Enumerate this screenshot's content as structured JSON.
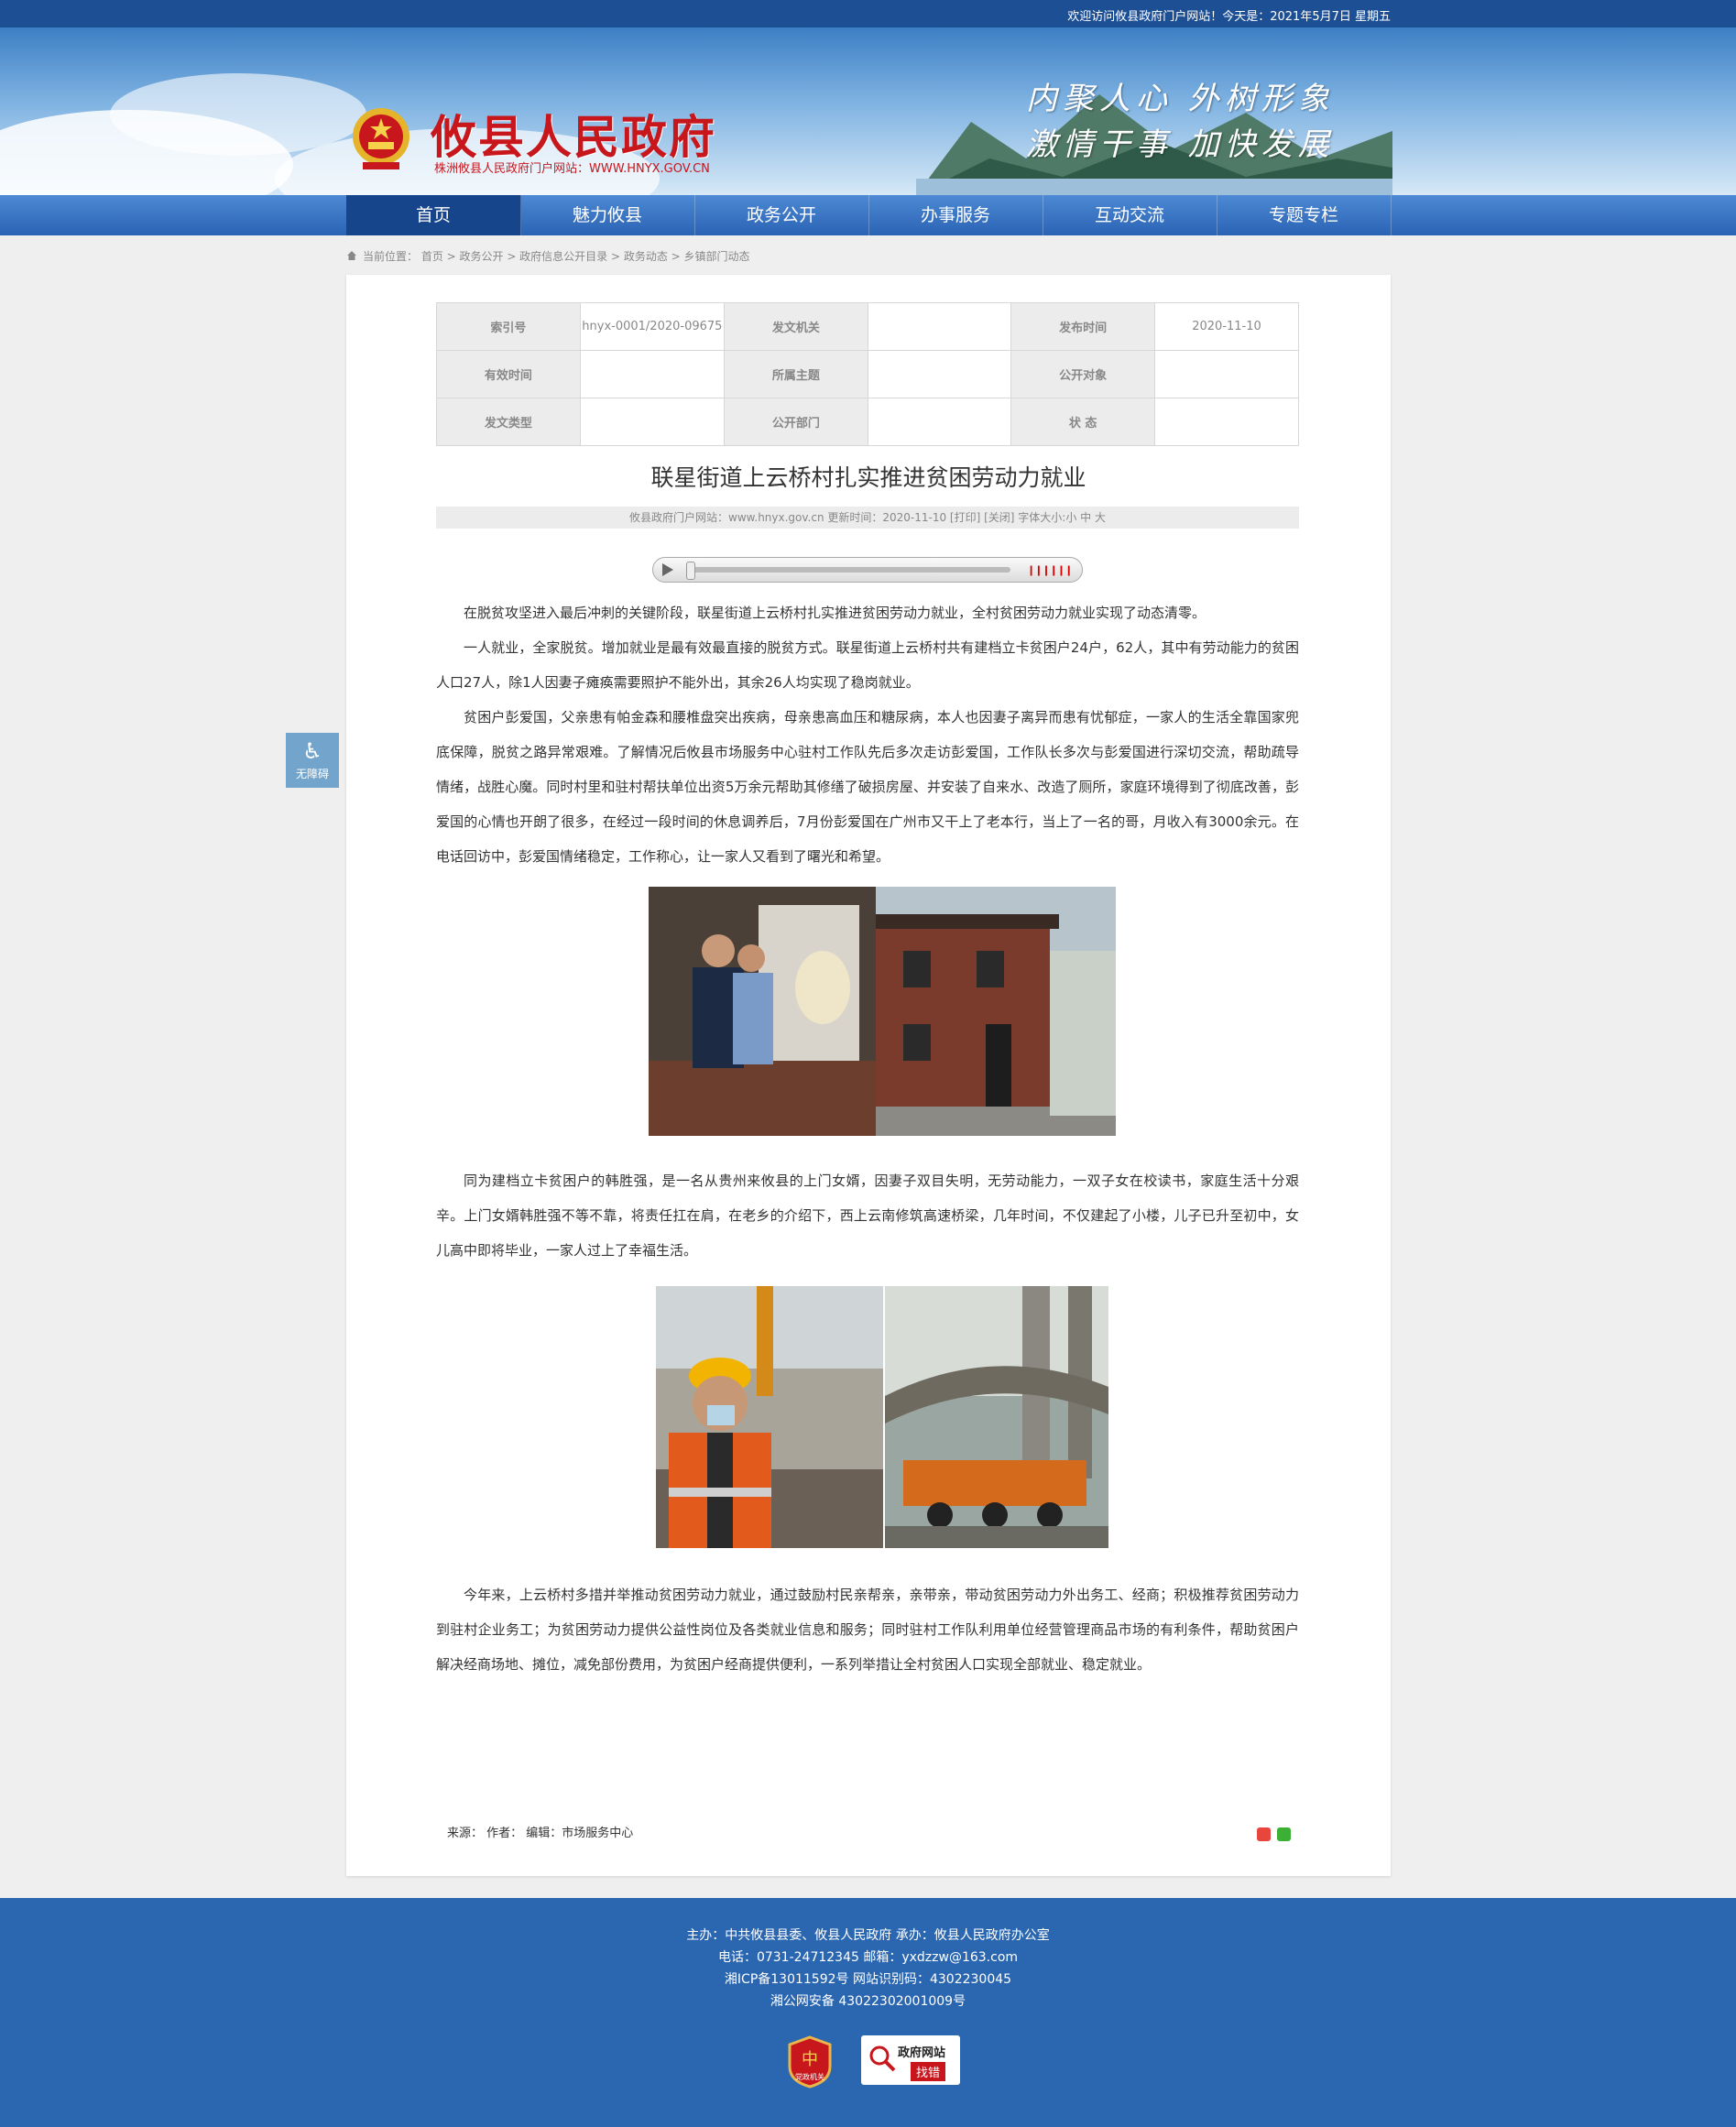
{
  "topbar": {
    "welcome": "欢迎访问攸县政府门户网站！今天是：2021年5月7日 星期五"
  },
  "header": {
    "title": "攸县人民政府",
    "subtitle": "株洲攸县人民政府门户网站：WWW.HNYX.GOV.CN",
    "slogan_line1": "内聚人心 外树形象",
    "slogan_line2": "激情干事 加快发展"
  },
  "nav": {
    "items": [
      "首页",
      "魅力攸县",
      "政务公开",
      "办事服务",
      "互动交流",
      "专题专栏"
    ]
  },
  "breadcrumb": {
    "text": "当前位置： 首页 > 政务公开 > 政府信息公开目录 > 政务动态 > 乡镇部门动态"
  },
  "meta": {
    "rows": [
      [
        {
          "label": "索引号",
          "value": "hnyx-0001/2020-09675"
        },
        {
          "label": "发文机关",
          "value": ""
        },
        {
          "label": "发布时间",
          "value": "2020-11-10"
        }
      ],
      [
        {
          "label": "有效时间",
          "value": ""
        },
        {
          "label": "所属主题",
          "value": ""
        },
        {
          "label": "公开对象",
          "value": ""
        }
      ],
      [
        {
          "label": "发文类型",
          "value": ""
        },
        {
          "label": "公开部门",
          "value": ""
        },
        {
          "label": "状 态",
          "value": ""
        }
      ]
    ]
  },
  "article": {
    "title": "联星街道上云桥村扎实推进贫困劳动力就业",
    "info": "攸县政府门户网站：www.hnyx.gov.cn   更新时间：2020-11-10   [打印] [关闭]   字体大小:小 中 大",
    "p1": "在脱贫攻坚进入最后冲刺的关键阶段，联星街道上云桥村扎实推进贫困劳动力就业，全村贫困劳动力就业实现了动态清零。",
    "p2": "一人就业，全家脱贫。增加就业是最有效最直接的脱贫方式。联星街道上云桥村共有建档立卡贫困户24户，62人，其中有劳动能力的贫困人口27人，除1人因妻子瘫痪需要照护不能外出，其余26人均实现了稳岗就业。",
    "p3": "贫困户彭爱国，父亲患有帕金森和腰椎盘突出疾病，母亲患高血压和糖尿病，本人也因妻子离异而患有忧郁症，一家人的生活全靠国家兜底保障，脱贫之路异常艰难。了解情况后攸县市场服务中心驻村工作队先后多次走访彭爱国，工作队长多次与彭爱国进行深切交流，帮助疏导情绪，战胜心魔。同时村里和驻村帮扶单位出资5万余元帮助其修缮了破损房屋、并安装了自来水、改造了厕所，家庭环境得到了彻底改善，彭爱国的心情也开朗了很多，在经过一段时间的休息调养后，7月份彭爱国在广州市又干上了老本行，当上了一名的哥，月收入有3000余元。在电话回访中，彭爱国情绪稳定，工作称心，让一家人又看到了曙光和希望。",
    "p4": "同为建档立卡贫困户的韩胜强，是一名从贵州来攸县的上门女婿，因妻子双目失明，无劳动能力，一双子女在校读书，家庭生活十分艰辛。上门女婿韩胜强不等不靠，将责任扛在肩，在老乡的介绍下，西上云南修筑高速桥梁，几年时间，不仅建起了小楼，儿子已升至初中，女儿高中即将毕业，一家人过上了幸福生活。",
    "p5": "今年来，上云桥村多措并举推动贫困劳动力就业，通过鼓励村民亲帮亲，亲带亲，带动贫困劳动力外出务工、经商；积极推荐贫困劳动力到驻村企业务工；为贫困劳动力提供公益性岗位及各类就业信息和服务；同时驻村工作队利用单位经营管理商品市场的有利条件，帮助贫困户解决经商场地、摊位，减免部份费用，为贫困户经商提供便利，一系列举措让全村贫困人口实现全部就业、稳定就业。",
    "source": "来源：     作者：     编辑：市场服务中心"
  },
  "a11y": {
    "label": "无障碍"
  },
  "footer": {
    "line1": "主办：中共攸县县委、攸县人民政府 承办：攸县人民政府办公室",
    "line2": "电话：0731-24712345 邮箱：yxdzzw@163.com",
    "line3": "湘ICP备13011592号   网站识别码：4302230045",
    "line4": "湘公网安备 43022302001009号",
    "badge1": "党政机关",
    "badge2_top": "政府网站",
    "badge2_bottom": "找错"
  },
  "colors": {
    "brand_red": "#c8161d",
    "nav_blue": "#2a63b4",
    "footer_blue": "#2b66b0"
  }
}
